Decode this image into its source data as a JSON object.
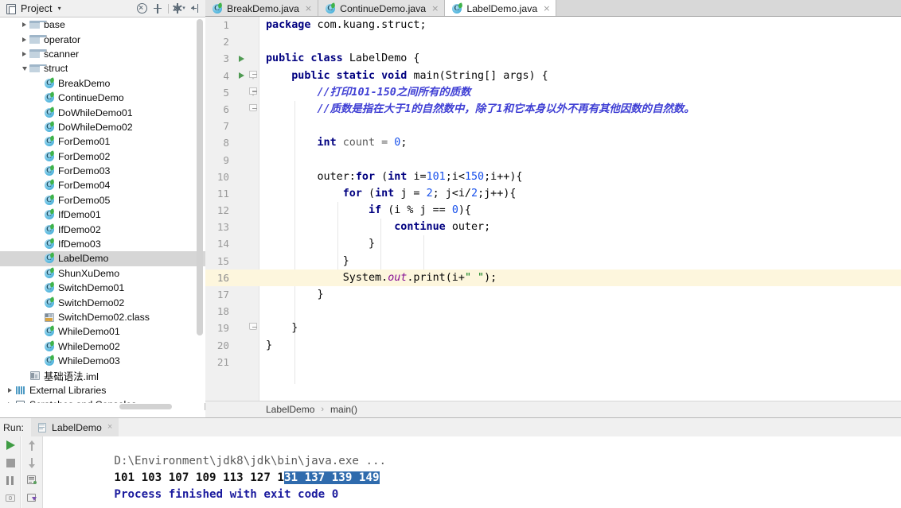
{
  "project_panel": {
    "title": "Project",
    "caret": "▾",
    "tools": [
      {
        "name": "collapse-all-icon",
        "label": "Collapse All"
      },
      {
        "name": "locate-icon",
        "label": "Select Opened File"
      },
      {
        "name": "settings-gear-icon",
        "label": "Settings"
      },
      {
        "name": "hide-panel-icon",
        "label": "Hide"
      }
    ],
    "tree": [
      {
        "label": "base",
        "icon": "folder",
        "indent": 1,
        "twisty": "right",
        "selected": false
      },
      {
        "label": "operator",
        "icon": "folder",
        "indent": 1,
        "twisty": "right",
        "selected": false
      },
      {
        "label": "scanner",
        "icon": "folder",
        "indent": 1,
        "twisty": "right",
        "selected": false
      },
      {
        "label": "struct",
        "icon": "folder",
        "indent": 1,
        "twisty": "down",
        "selected": false
      },
      {
        "label": "BreakDemo",
        "icon": "java",
        "indent": 2,
        "twisty": "none",
        "selected": false
      },
      {
        "label": "ContinueDemo",
        "icon": "java",
        "indent": 2,
        "twisty": "none",
        "selected": false
      },
      {
        "label": "DoWhileDemo01",
        "icon": "java",
        "indent": 2,
        "twisty": "none",
        "selected": false
      },
      {
        "label": "DoWhileDemo02",
        "icon": "java",
        "indent": 2,
        "twisty": "none",
        "selected": false
      },
      {
        "label": "ForDemo01",
        "icon": "java",
        "indent": 2,
        "twisty": "none",
        "selected": false
      },
      {
        "label": "ForDemo02",
        "icon": "java",
        "indent": 2,
        "twisty": "none",
        "selected": false
      },
      {
        "label": "ForDemo03",
        "icon": "java",
        "indent": 2,
        "twisty": "none",
        "selected": false
      },
      {
        "label": "ForDemo04",
        "icon": "java",
        "indent": 2,
        "twisty": "none",
        "selected": false
      },
      {
        "label": "ForDemo05",
        "icon": "java",
        "indent": 2,
        "twisty": "none",
        "selected": false
      },
      {
        "label": "IfDemo01",
        "icon": "java",
        "indent": 2,
        "twisty": "none",
        "selected": false
      },
      {
        "label": "IfDemo02",
        "icon": "java",
        "indent": 2,
        "twisty": "none",
        "selected": false
      },
      {
        "label": "IfDemo03",
        "icon": "java",
        "indent": 2,
        "twisty": "none",
        "selected": false
      },
      {
        "label": "LabelDemo",
        "icon": "java",
        "indent": 2,
        "twisty": "none",
        "selected": true
      },
      {
        "label": "ShunXuDemo",
        "icon": "java",
        "indent": 2,
        "twisty": "none",
        "selected": false
      },
      {
        "label": "SwitchDemo01",
        "icon": "java",
        "indent": 2,
        "twisty": "none",
        "selected": false
      },
      {
        "label": "SwitchDemo02",
        "icon": "java",
        "indent": 2,
        "twisty": "none",
        "selected": false
      },
      {
        "label": "SwitchDemo02.class",
        "icon": "class",
        "indent": 2,
        "twisty": "none",
        "selected": false
      },
      {
        "label": "WhileDemo01",
        "icon": "java",
        "indent": 2,
        "twisty": "none",
        "selected": false
      },
      {
        "label": "WhileDemo02",
        "icon": "java",
        "indent": 2,
        "twisty": "none",
        "selected": false
      },
      {
        "label": "WhileDemo03",
        "icon": "java",
        "indent": 2,
        "twisty": "none",
        "selected": false
      },
      {
        "label": "基础语法.iml",
        "icon": "iml",
        "indent": 1,
        "twisty": "none",
        "selected": false
      },
      {
        "label": "External Libraries",
        "icon": "lib",
        "indent": 0,
        "twisty": "right",
        "selected": false
      },
      {
        "label": "Scratches and Consoles",
        "icon": "scratch",
        "indent": 0,
        "twisty": "right",
        "selected": false
      }
    ]
  },
  "editor": {
    "tabs": [
      {
        "label": "BreakDemo.java",
        "active": false,
        "close": "×"
      },
      {
        "label": "ContinueDemo.java",
        "active": false,
        "close": "×"
      },
      {
        "label": "LabelDemo.java",
        "active": true,
        "close": "×"
      }
    ],
    "current_line": 16,
    "run_marker_lines": [
      3,
      4
    ],
    "line_numbers": [
      "1",
      "2",
      "3",
      "4",
      "5",
      "6",
      "7",
      "8",
      "9",
      "10",
      "11",
      "12",
      "13",
      "14",
      "15",
      "16",
      "17",
      "18",
      "19",
      "20",
      "21"
    ],
    "code_lines": [
      [
        {
          "t": "package ",
          "c": "kw"
        },
        {
          "t": "com.kuang.struct;",
          "c": "pl"
        }
      ],
      [],
      [
        {
          "t": "public class ",
          "c": "kw"
        },
        {
          "t": "LabelDemo {",
          "c": "pl"
        }
      ],
      [
        {
          "t": "    public static void ",
          "c": "kw"
        },
        {
          "t": "main(String[] args) {",
          "c": "pl"
        }
      ],
      [
        {
          "t": "        //打印101-150之间所有的质数",
          "c": "cmt"
        }
      ],
      [
        {
          "t": "        //质数是指在大于1的自然数中，除了1和它本身以外不再有其他因数的自然数。",
          "c": "cmt"
        }
      ],
      [],
      [
        {
          "t": "        ",
          "c": "pl"
        },
        {
          "t": "int ",
          "c": "kw"
        },
        {
          "t": "count = ",
          "c": "dim"
        },
        {
          "t": "0",
          "c": "num"
        },
        {
          "t": ";",
          "c": "pl"
        }
      ],
      [],
      [
        {
          "t": "        outer:",
          "c": "pl"
        },
        {
          "t": "for ",
          "c": "kw"
        },
        {
          "t": "(",
          "c": "pl"
        },
        {
          "t": "int ",
          "c": "kw"
        },
        {
          "t": "i=",
          "c": "pl"
        },
        {
          "t": "101",
          "c": "num"
        },
        {
          "t": ";i<",
          "c": "pl"
        },
        {
          "t": "150",
          "c": "num"
        },
        {
          "t": ";i++){",
          "c": "pl"
        }
      ],
      [
        {
          "t": "            ",
          "c": "pl"
        },
        {
          "t": "for ",
          "c": "kw"
        },
        {
          "t": "(",
          "c": "pl"
        },
        {
          "t": "int ",
          "c": "kw"
        },
        {
          "t": "j = ",
          "c": "pl"
        },
        {
          "t": "2",
          "c": "num"
        },
        {
          "t": "; j<i/",
          "c": "pl"
        },
        {
          "t": "2",
          "c": "num"
        },
        {
          "t": ";j++){",
          "c": "pl"
        }
      ],
      [
        {
          "t": "                ",
          "c": "pl"
        },
        {
          "t": "if ",
          "c": "kw"
        },
        {
          "t": "(i % j == ",
          "c": "pl"
        },
        {
          "t": "0",
          "c": "num"
        },
        {
          "t": "){",
          "c": "pl"
        }
      ],
      [
        {
          "t": "                    ",
          "c": "pl"
        },
        {
          "t": "continue ",
          "c": "kw"
        },
        {
          "t": "outer;",
          "c": "pl"
        }
      ],
      [
        {
          "t": "                }",
          "c": "pl"
        }
      ],
      [
        {
          "t": "            }",
          "c": "pl"
        }
      ],
      [
        {
          "t": "            System.",
          "c": "pl"
        },
        {
          "t": "out",
          "c": "fld"
        },
        {
          "t": ".print(i+",
          "c": "pl"
        },
        {
          "t": "\" \"",
          "c": "str"
        },
        {
          "t": ");",
          "c": "pl"
        }
      ],
      [
        {
          "t": "        }",
          "c": "pl"
        }
      ],
      [],
      [
        {
          "t": "    }",
          "c": "pl"
        }
      ],
      [
        {
          "t": "}",
          "c": "pl"
        }
      ],
      []
    ],
    "breadcrumb": {
      "items": [
        "LabelDemo",
        "main()"
      ],
      "separator": "›"
    }
  },
  "run_panel": {
    "label": "Run:",
    "tab": {
      "label": "LabelDemo",
      "close": "×"
    },
    "left_buttons": [
      {
        "name": "rerun-button",
        "icon": "play"
      },
      {
        "name": "stop-button",
        "icon": "stop"
      },
      {
        "name": "pause-button",
        "icon": "pause"
      },
      {
        "name": "screenshot-button",
        "icon": "camera"
      }
    ],
    "side_buttons": [
      {
        "name": "scroll-up-button",
        "icon": "arrow-up"
      },
      {
        "name": "scroll-down-button",
        "icon": "arrow-down"
      },
      {
        "name": "soft-wrap-button",
        "icon": "wrap"
      },
      {
        "name": "print-button",
        "icon": "print"
      }
    ],
    "console": {
      "command_line": "D:\\Environment\\jdk8\\jdk\\bin\\java.exe ...",
      "output_prefix": "101 103 107 109 113 127 1",
      "output_selected": "31 137 139 149",
      "exit_line": "Process finished with exit code 0"
    }
  },
  "colors": {
    "keyword": "#000080",
    "number": "#1750eb",
    "string": "#067d17",
    "comment": "#3f3fd4",
    "field": "#871094",
    "current_line": "#fdf6dd",
    "selection": "#2f6bad",
    "tree_selected": "#d6d6d6",
    "run_green": "#3f9c44"
  }
}
